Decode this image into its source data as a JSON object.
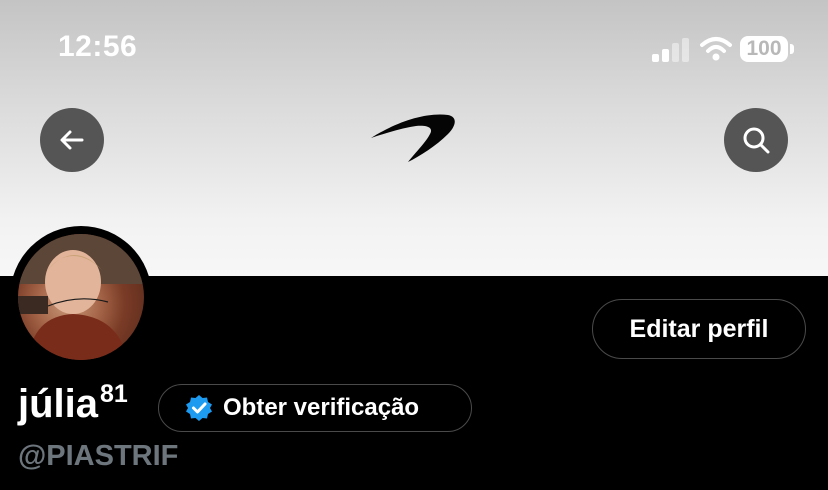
{
  "status_bar": {
    "time": "12:56",
    "battery_level": "100",
    "signal_icon": "cellular-signal-icon",
    "wifi_icon": "wifi-icon"
  },
  "header": {
    "back_icon": "arrow-left-icon",
    "search_icon": "search-icon",
    "logo": "mclaren-speedmark-logo"
  },
  "profile": {
    "display_name": "júlia",
    "display_name_superscript": "81",
    "handle": "@PIASTRIF",
    "edit_button_label": "Editar perfil",
    "verify_button_label": "Obter verificação",
    "verify_icon": "verified-badge-icon"
  },
  "colors": {
    "accent": "#1d9bf0",
    "background": "#000000",
    "handle_text": "#6e767d",
    "button_border": "#4a4a4a"
  }
}
